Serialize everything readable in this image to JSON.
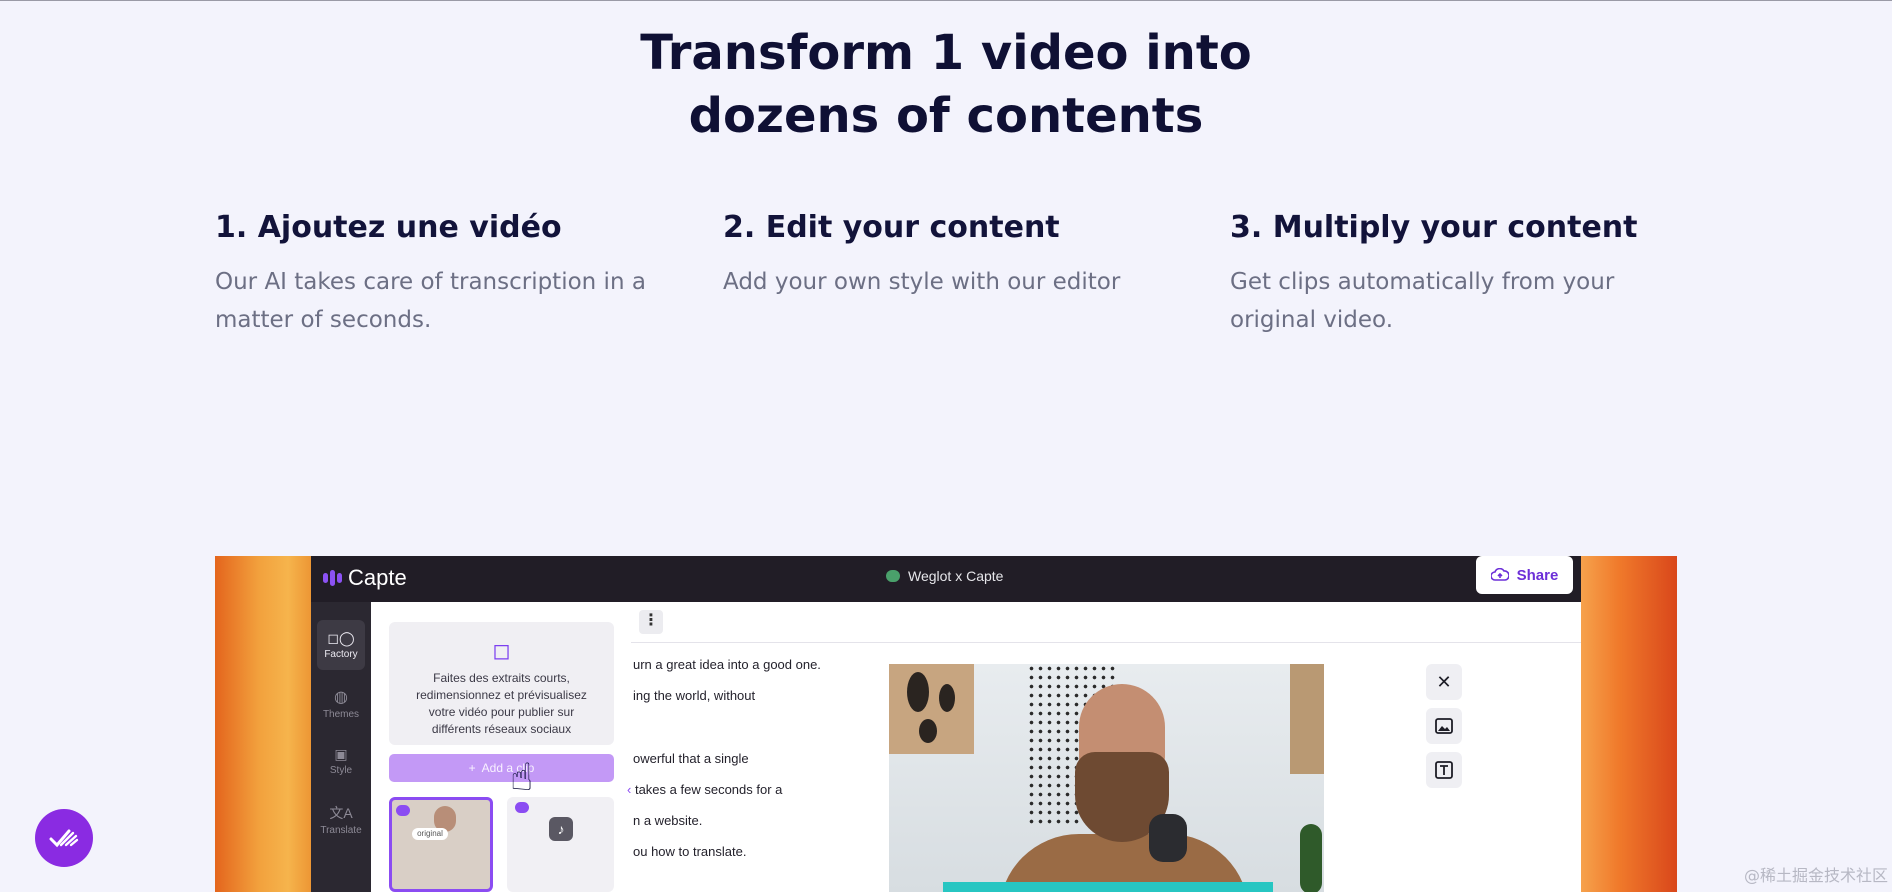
{
  "heading": {
    "line1": "Transform 1 video into",
    "line2": "dozens of contents"
  },
  "steps": [
    {
      "title": "1. Ajoutez une vidéo",
      "text": "Our AI takes care of transcription in a matter of seconds."
    },
    {
      "title": "2. Edit your content",
      "text": "Add your own style with our editor"
    },
    {
      "title": "3. Multiply your content",
      "text": "Get clips automatically from your original video."
    }
  ],
  "app": {
    "logo": "Capte",
    "project": "Weglot x Capte",
    "share_label": "Share",
    "rail": [
      "Factory",
      "Themes",
      "Style",
      "Translate"
    ],
    "card_text": "Faites des extraits courts, redimensionnez et prévisualisez votre vidéo pour publier sur différents réseaux sociaux",
    "add_clip_label": "Add a clip",
    "thumb_badge": "original",
    "transcript": [
      "urn a great idea into a good one.",
      "ing the world, without",
      "owerful that a single",
      "takes a few seconds for a",
      "n a website.",
      "ou how to translate."
    ]
  },
  "colors": {
    "accent": "#8b4cf2",
    "titlebar": "#211d26",
    "heading": "#0f1034"
  },
  "watermark": "@稀土掘金技术社区"
}
